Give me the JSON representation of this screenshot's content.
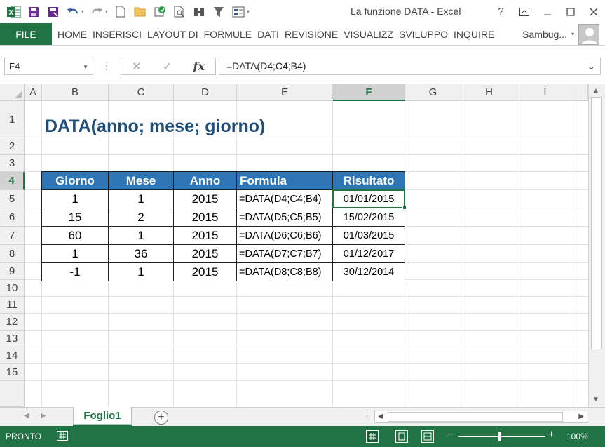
{
  "window": {
    "title": "La funzione DATA - Excel",
    "help": "?"
  },
  "qat": {
    "icons": [
      "excel-logo-icon",
      "save-icon",
      "save-as-icon",
      "undo-icon",
      "redo-icon",
      "new-icon",
      "open-icon",
      "refresh-icon",
      "print-preview-icon",
      "find-icon",
      "filter-icon",
      "form-icon",
      "customize-icon"
    ]
  },
  "ribbon": {
    "file": "FILE",
    "tabs": [
      "HOME",
      "INSERISCI",
      "LAYOUT DI",
      "FORMULE",
      "DATI",
      "REVISIONE",
      "VISUALIZZ",
      "SVILUPPO",
      "INQUIRE"
    ],
    "user": "Sambug..."
  },
  "formula_bar": {
    "name_box": "F4",
    "formula": "=DATA(D4;C4;B4)",
    "fx": "fx"
  },
  "columns": [
    "A",
    "B",
    "C",
    "D",
    "E",
    "F",
    "G",
    "H",
    "I"
  ],
  "rows": [
    "1",
    "2",
    "3",
    "4",
    "5",
    "6",
    "7",
    "8",
    "9",
    "10",
    "11",
    "12",
    "13",
    "14",
    "15"
  ],
  "active_cell": {
    "column": "F",
    "row": "4"
  },
  "sheet": {
    "title": "DATA(anno; mese; giorno)",
    "table": {
      "headers": [
        "Giorno",
        "Mese",
        "Anno",
        "Formula",
        "Risultato"
      ],
      "rows": [
        [
          "1",
          "1",
          "2015",
          "=DATA(D4;C4;B4)",
          "01/01/2015"
        ],
        [
          "15",
          "2",
          "2015",
          "=DATA(D5;C5;B5)",
          "15/02/2015"
        ],
        [
          "60",
          "1",
          "2015",
          "=DATA(D6;C6;B6)",
          "01/03/2015"
        ],
        [
          "1",
          "36",
          "2015",
          "=DATA(D7;C7;B7)",
          "01/12/2017"
        ],
        [
          "-1",
          "1",
          "2015",
          "=DATA(D8;C8;B8)",
          "30/12/2014"
        ]
      ]
    }
  },
  "sheet_tabs": {
    "active": "Foglio1",
    "add": "+"
  },
  "status": {
    "text": "PRONTO",
    "zoom": "100%",
    "zoom_level_percent": 100
  }
}
